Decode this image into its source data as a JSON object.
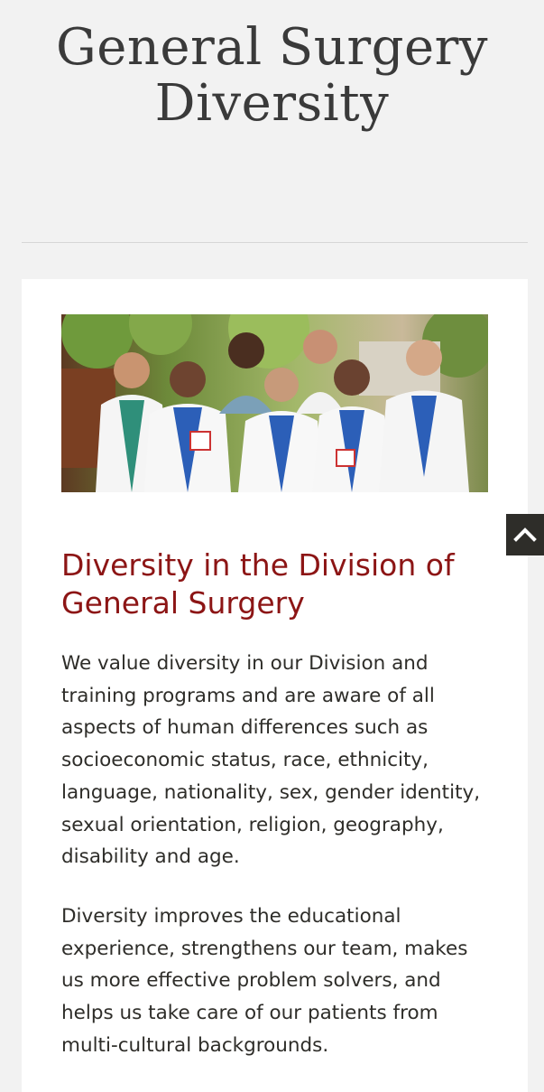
{
  "page": {
    "title_line1": "General Surgery",
    "title_line2": "Diversity"
  },
  "hero_image": {
    "alt": "Group of surgical residents in white coats"
  },
  "content": {
    "heading": "Diversity in the Division of General Surgery",
    "paragraph1": "We value diversity in our Division and training programs and are aware of all aspects of human differences such as socioeconomic status, race, ethnicity, language, nationality, sex, gender identity, sexual orientation, religion, geography, disability and age.",
    "paragraph2": "Diversity improves the educational experience, strengthens our team, makes us more effective problem solvers, and helps us take care of our patients from multi-cultural backgrounds."
  },
  "back_to_top": {
    "icon": "chevron-up-icon"
  },
  "colors": {
    "background": "#f2f2f2",
    "card": "#ffffff",
    "heading": "#8c1515",
    "title": "#3a3a3a",
    "body_text": "#2e2d29",
    "back_to_top_bg": "#2e2d29"
  }
}
